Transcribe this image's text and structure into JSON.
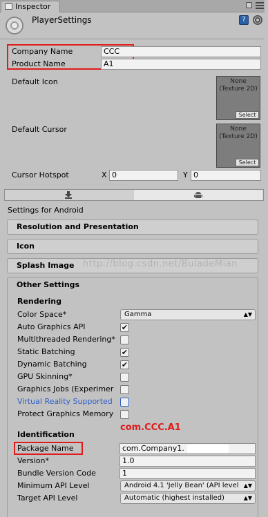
{
  "window": {
    "tab_label": "Inspector"
  },
  "header": {
    "title": "PlayerSettings",
    "help_glyph": "?"
  },
  "company": {
    "label": "Company Name",
    "value": "CCC"
  },
  "product": {
    "label": "Product Name",
    "value": "A1"
  },
  "default_icon": {
    "label": "Default Icon",
    "texture_text": "None (Texture 2D)",
    "select_label": "Select"
  },
  "default_cursor": {
    "label": "Default Cursor",
    "texture_text": "None (Texture 2D)",
    "select_label": "Select"
  },
  "cursor_hotspot": {
    "label": "Cursor Hotspot",
    "x_label": "X",
    "x_value": "0",
    "y_label": "Y",
    "y_value": "0"
  },
  "platform": {
    "settings_for": "Settings for Android"
  },
  "sections": {
    "resolution": "Resolution and Presentation",
    "icon": "Icon",
    "splash": "Splash Image",
    "other": "Other Settings"
  },
  "watermark": "http://blog.csdn.net/BuladeMian",
  "rendering": {
    "heading": "Rendering",
    "color_space": {
      "label": "Color Space*",
      "value": "Gamma"
    },
    "items": [
      {
        "label": "Auto Graphics API",
        "checked": true
      },
      {
        "label": "Multithreaded Rendering*",
        "checked": false
      },
      {
        "label": "Static Batching",
        "checked": true
      },
      {
        "label": "Dynamic Batching",
        "checked": true
      },
      {
        "label": "GPU Skinning*",
        "checked": false
      },
      {
        "label": "Graphics Jobs (Experimer",
        "checked": false
      },
      {
        "label": "Virtual Reality Supported",
        "checked": false
      },
      {
        "label": "Protect Graphics Memory",
        "checked": false
      }
    ]
  },
  "annotation": {
    "text": "com.CCC.A1",
    "color": "#e21a1a"
  },
  "identification": {
    "heading": "Identification",
    "package_name": {
      "label": "Package Name",
      "value": "com.Company1."
    },
    "version": {
      "label": "Version*",
      "value": "1.0"
    },
    "bundle_version_code": {
      "label": "Bundle Version Code",
      "value": "1"
    },
    "min_api": {
      "label": "Minimum API Level",
      "value": "Android 4.1 'Jelly Bean' (API level"
    },
    "target_api": {
      "label": "Target API Level",
      "value": "Automatic (highest installed)"
    }
  },
  "colors": {
    "highlight_red": "#e21a1a",
    "vr_blue": "#2f5ec8",
    "help_blue": "#2b5fa6"
  },
  "icons": [
    "inspector-icon",
    "lock-icon",
    "menu-icon",
    "settings-gear-icon",
    "help-icon",
    "cog-icon",
    "download-icon",
    "android-icon",
    "checkmark-icon",
    "dropdown-arrow-icon"
  ]
}
